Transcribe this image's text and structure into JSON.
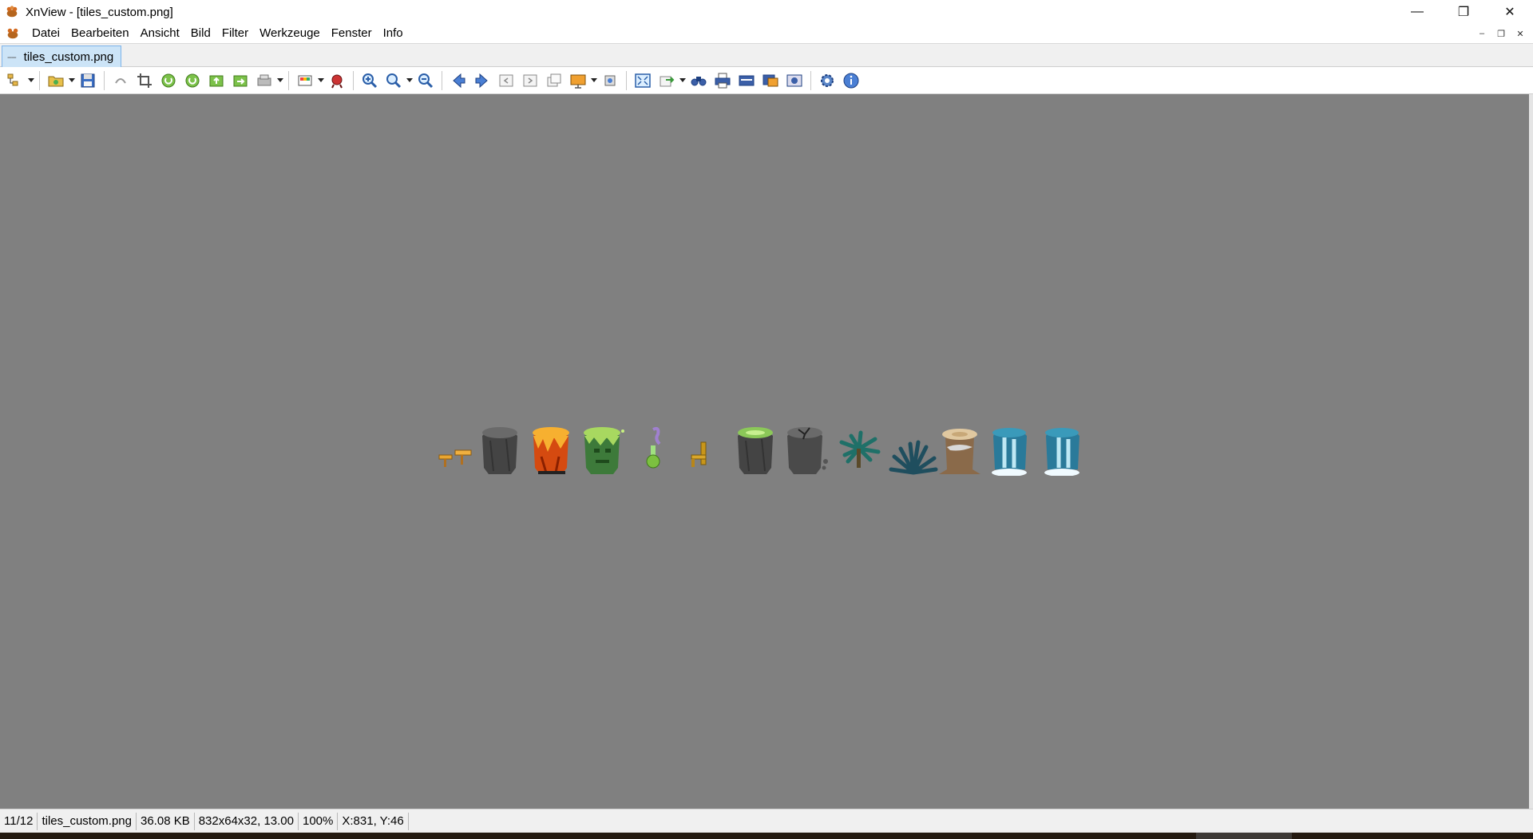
{
  "window": {
    "title": "XnView - [tiles_custom.png]",
    "controls": {
      "minimize": "—",
      "restore": "❐",
      "close": "✕"
    }
  },
  "menu": {
    "items": [
      "Datei",
      "Bearbeiten",
      "Ansicht",
      "Bild",
      "Filter",
      "Werkzeuge",
      "Fenster",
      "Info"
    ],
    "mdi": {
      "minimize": "–",
      "restore": "❐",
      "close": "✕"
    }
  },
  "tabs": [
    {
      "mark": "----",
      "label": "tiles_custom.png",
      "active": true
    }
  ],
  "toolbar": {
    "buttons": [
      "browser-icon",
      "open-icon",
      "save-icon",
      "undo-icon",
      "crop-icon",
      "rotate-left-icon",
      "rotate-right-icon",
      "prev-image-icon",
      "next-image-icon",
      "acquire-icon",
      "palette-icon",
      "effects-icon",
      "zoom-in-icon",
      "zoom-icon",
      "zoom-out-icon",
      "back-arrow-icon",
      "forward-arrow-icon",
      "first-icon",
      "last-icon",
      "window-icon",
      "slideshow-icon",
      "capture-icon",
      "fullscreen-icon",
      "export-icon",
      "search-icon",
      "print-icon",
      "scanner-icon",
      "convert-icon",
      "screenshot-icon",
      "settings-icon",
      "info-icon"
    ]
  },
  "canvas": {
    "background": "#808080",
    "image": {
      "name": "tiles_custom.png",
      "tiles": [
        "signpost",
        "dark-rock-pillar",
        "lava-pillar",
        "green-face-pillar",
        "purple-potion",
        "golden-chair",
        "slime-rock-pillar",
        "cracked-rock-pillar",
        "teal-palm",
        "teal-fern",
        "tree-stump",
        "waterfall-left",
        "waterfall-right"
      ]
    }
  },
  "status": {
    "index": "11/12",
    "filename": "tiles_custom.png",
    "filesize": "36.08 KB",
    "dimensions": "832x64x32, 13.00",
    "zoom": "100%",
    "coords": "X:831, Y:46"
  }
}
